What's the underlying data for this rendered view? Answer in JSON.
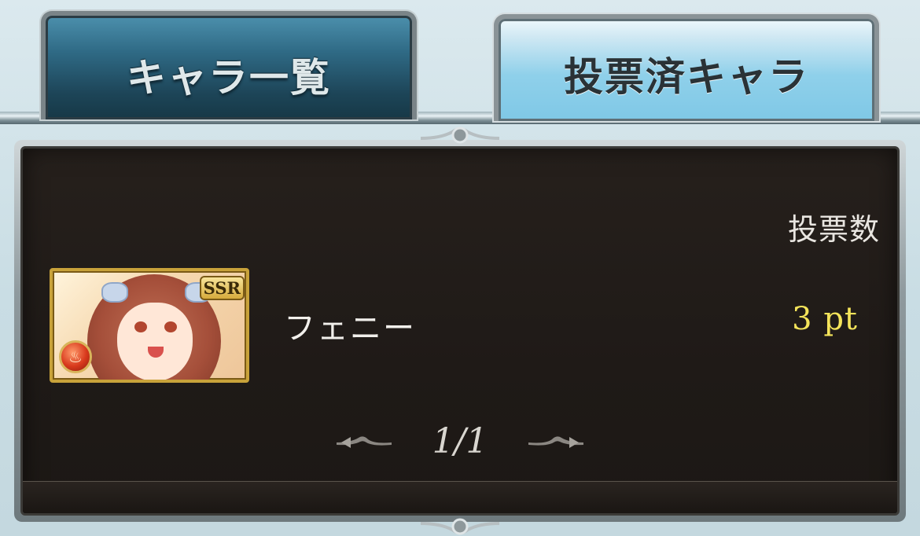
{
  "tabs": [
    {
      "label": "キャラ一覧",
      "active": false
    },
    {
      "label": "投票済キャラ",
      "active": true
    }
  ],
  "panel": {
    "votes_header": "投票数"
  },
  "character_list": [
    {
      "name": "フェニー",
      "votes": "3 pt",
      "rarity": "SSR",
      "element": "fire"
    }
  ],
  "pager": {
    "page_indicator": "1/1"
  },
  "colors": {
    "vote_value": "#f4e45a",
    "panel_bg": "#1f1a17",
    "active_tab": "#8fd0ea",
    "inactive_tab": "#2f6a85"
  },
  "icons": {
    "element": "fire-element-icon",
    "prev": "ornate-left-arrow-icon",
    "next": "ornate-right-arrow-icon"
  }
}
